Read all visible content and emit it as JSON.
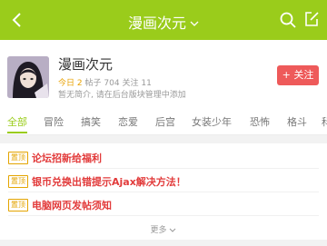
{
  "header": {
    "title": "漫画次元"
  },
  "forum": {
    "name": "漫画次元",
    "today_label": "今日",
    "today_value": "2",
    "posts_label": "帖子",
    "posts_value": "704",
    "follows_label": "关注",
    "follows_value": "11",
    "intro": "暂无简介, 请在后台版块管理中添加",
    "follow_label": "+ 关注"
  },
  "tabs": [
    "全部",
    "冒险",
    "搞笑",
    "恋爱",
    "后宫",
    "女装少年",
    "恐怖",
    "格斗",
    "科"
  ],
  "sticky": {
    "badge": "置顶",
    "items": [
      "论坛招新给福利",
      "银币兑换出错提示Ajax解决方法！",
      "电脑网页发帖须知"
    ]
  },
  "more_label": "更多",
  "colors": {
    "accent": "#9acc1b",
    "follow": "#ee5a5a",
    "sticky": "#e23b3b"
  }
}
